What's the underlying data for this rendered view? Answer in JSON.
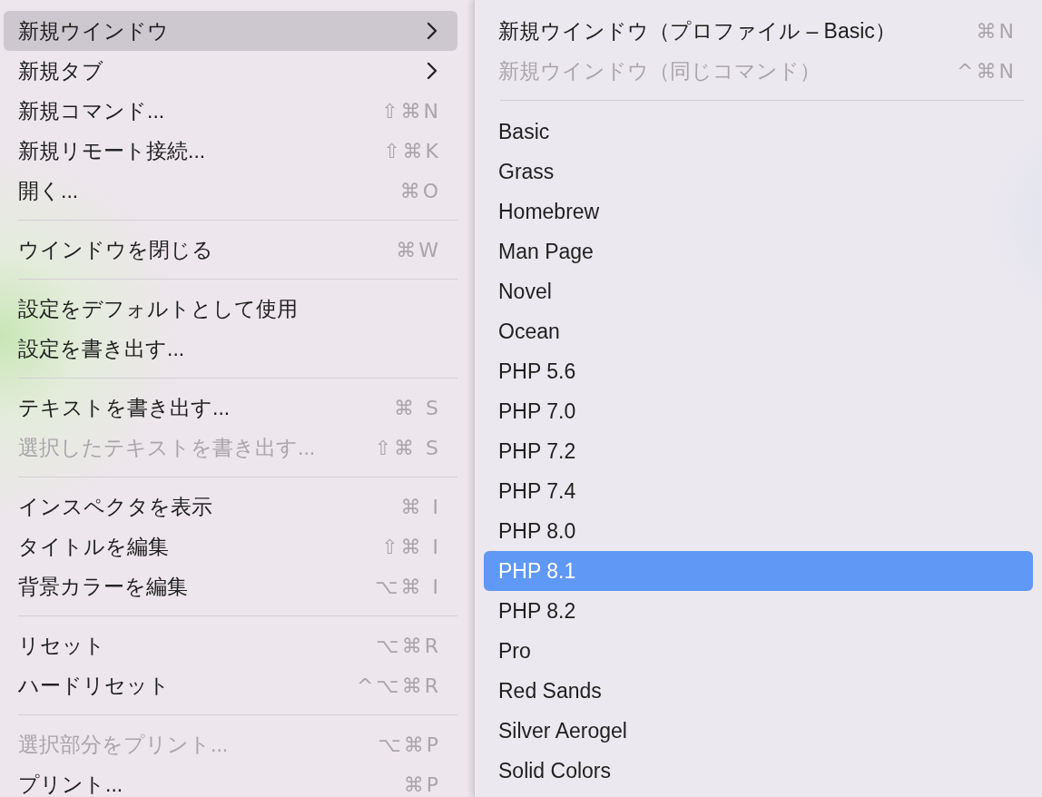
{
  "menu": {
    "items": [
      {
        "kind": "item",
        "label": "新規ウインドウ",
        "submenu": true,
        "selected": true,
        "disabled": false
      },
      {
        "kind": "item",
        "label": "新規タブ",
        "submenu": true,
        "selected": false,
        "disabled": false
      },
      {
        "kind": "item",
        "label": "新規コマンド...",
        "shortcut": "⇧⌘N",
        "submenu": false,
        "selected": false,
        "disabled": false
      },
      {
        "kind": "item",
        "label": "新規リモート接続...",
        "shortcut": "⇧⌘K",
        "submenu": false,
        "selected": false,
        "disabled": false
      },
      {
        "kind": "item",
        "label": "開く...",
        "shortcut": "⌘O",
        "submenu": false,
        "selected": false,
        "disabled": false
      },
      {
        "kind": "separator"
      },
      {
        "kind": "item",
        "label": "ウインドウを閉じる",
        "shortcut": "⌘W",
        "submenu": false,
        "selected": false,
        "disabled": false
      },
      {
        "kind": "separator"
      },
      {
        "kind": "item",
        "label": "設定をデフォルトとして使用",
        "submenu": false,
        "selected": false,
        "disabled": false
      },
      {
        "kind": "item",
        "label": "設定を書き出す...",
        "submenu": false,
        "selected": false,
        "disabled": false
      },
      {
        "kind": "separator"
      },
      {
        "kind": "item",
        "label": "テキストを書き出す...",
        "shortcut": "⌘ S",
        "submenu": false,
        "selected": false,
        "disabled": false
      },
      {
        "kind": "item",
        "label": "選択したテキストを書き出す...",
        "shortcut": "⇧⌘ S",
        "submenu": false,
        "selected": false,
        "disabled": true
      },
      {
        "kind": "separator"
      },
      {
        "kind": "item",
        "label": "インスペクタを表示",
        "shortcut": "⌘ I",
        "submenu": false,
        "selected": false,
        "disabled": false
      },
      {
        "kind": "item",
        "label": "タイトルを編集",
        "shortcut": "⇧⌘ I",
        "submenu": false,
        "selected": false,
        "disabled": false
      },
      {
        "kind": "item",
        "label": "背景カラーを編集",
        "shortcut": "⌥⌘ I",
        "submenu": false,
        "selected": false,
        "disabled": false
      },
      {
        "kind": "separator"
      },
      {
        "kind": "item",
        "label": "リセット",
        "shortcut": "⌥⌘R",
        "submenu": false,
        "selected": false,
        "disabled": false
      },
      {
        "kind": "item",
        "label": "ハードリセット",
        "shortcut": "^⌥⌘R",
        "submenu": false,
        "selected": false,
        "disabled": false
      },
      {
        "kind": "separator"
      },
      {
        "kind": "item",
        "label": "選択部分をプリント...",
        "shortcut": "⌥⌘P",
        "submenu": false,
        "selected": false,
        "disabled": true
      },
      {
        "kind": "item",
        "label": "プリント...",
        "shortcut": "⌘P",
        "submenu": false,
        "selected": false,
        "disabled": false
      }
    ]
  },
  "submenu": {
    "items": [
      {
        "kind": "item",
        "label": "新規ウインドウ（プロファイル – Basic）",
        "shortcut": "⌘N",
        "selected": false,
        "disabled": false
      },
      {
        "kind": "item",
        "label": "新規ウインドウ（同じコマンド）",
        "shortcut": "^⌘N",
        "selected": false,
        "disabled": true
      },
      {
        "kind": "separator"
      },
      {
        "kind": "item",
        "label": "Basic",
        "selected": false,
        "disabled": false
      },
      {
        "kind": "item",
        "label": "Grass",
        "selected": false,
        "disabled": false
      },
      {
        "kind": "item",
        "label": "Homebrew",
        "selected": false,
        "disabled": false
      },
      {
        "kind": "item",
        "label": "Man Page",
        "selected": false,
        "disabled": false
      },
      {
        "kind": "item",
        "label": "Novel",
        "selected": false,
        "disabled": false
      },
      {
        "kind": "item",
        "label": "Ocean",
        "selected": false,
        "disabled": false
      },
      {
        "kind": "item",
        "label": "PHP 5.6",
        "selected": false,
        "disabled": false
      },
      {
        "kind": "item",
        "label": "PHP 7.0",
        "selected": false,
        "disabled": false
      },
      {
        "kind": "item",
        "label": "PHP 7.2",
        "selected": false,
        "disabled": false
      },
      {
        "kind": "item",
        "label": "PHP 7.4",
        "selected": false,
        "disabled": false
      },
      {
        "kind": "item",
        "label": "PHP 8.0",
        "selected": false,
        "disabled": false
      },
      {
        "kind": "item",
        "label": "PHP 8.1",
        "selected": true,
        "disabled": false
      },
      {
        "kind": "item",
        "label": "PHP 8.2",
        "selected": false,
        "disabled": false
      },
      {
        "kind": "item",
        "label": "Pro",
        "selected": false,
        "disabled": false
      },
      {
        "kind": "item",
        "label": "Red Sands",
        "selected": false,
        "disabled": false
      },
      {
        "kind": "item",
        "label": "Silver Aerogel",
        "selected": false,
        "disabled": false
      },
      {
        "kind": "item",
        "label": "Solid Colors",
        "selected": false,
        "disabled": false
      }
    ]
  }
}
